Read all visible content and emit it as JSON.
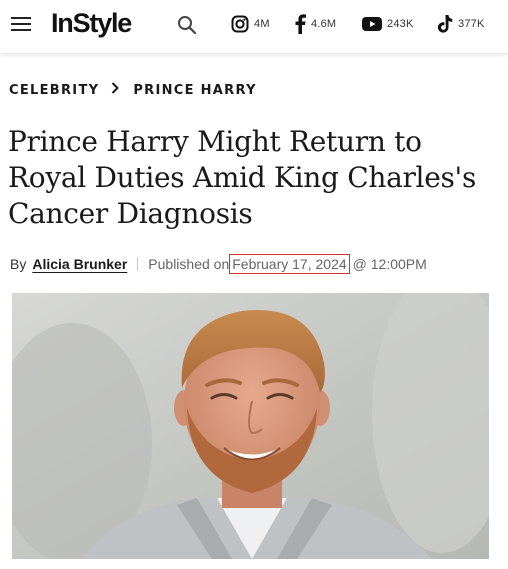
{
  "header": {
    "logo": "InStyle",
    "socials": [
      {
        "icon": "instagram-icon",
        "count": "4M"
      },
      {
        "icon": "facebook-icon",
        "count": "4.6M"
      },
      {
        "icon": "youtube-icon",
        "count": "243K"
      },
      {
        "icon": "tiktok-icon",
        "count": "377K"
      }
    ]
  },
  "breadcrumb": [
    "CELEBRITY",
    "PRINCE HARRY"
  ],
  "article": {
    "title": "Prince Harry Might Return to Royal Duties Amid King Charles's Cancer Diagnosis",
    "byline": {
      "by": "By",
      "author": "Alicia Brunker",
      "published_prefix": "Published on",
      "date": "February 17, 2024",
      "time": "@ 12:00PM"
    }
  },
  "colors": {
    "highlight_box": "#d3302f",
    "text": "#1a1a1a"
  }
}
